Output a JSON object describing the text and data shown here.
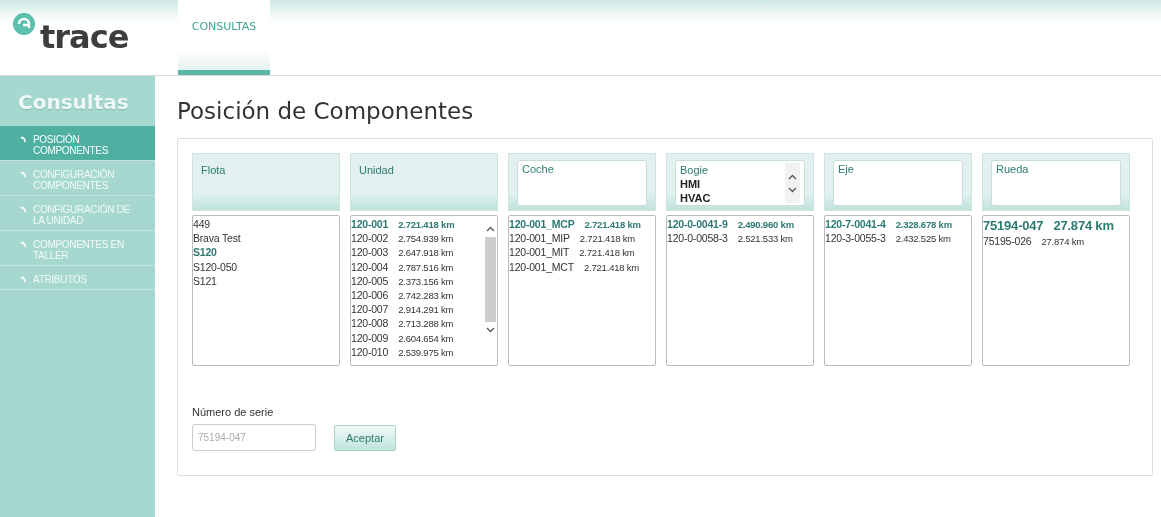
{
  "brand": {
    "name": "trace"
  },
  "top_tabs": [
    {
      "label": "CONSULTAS",
      "selected": true
    }
  ],
  "sidebar": {
    "title": "Consultas",
    "items": [
      {
        "label": "POSICIÓN COMPONENTES",
        "selected": true
      },
      {
        "label": "CONFIGURACIÓN COMPONENTES",
        "selected": false
      },
      {
        "label": "CONFIGURACIÓN DE LA UNIDAD",
        "selected": false
      },
      {
        "label": "COMPONENTES EN TALLER",
        "selected": false
      },
      {
        "label": "ATRIBUTOS",
        "selected": false
      }
    ]
  },
  "page_title": "Posición de Componentes",
  "panels": [
    {
      "label": "Flota",
      "kind": "label",
      "scrollable": false,
      "items": [
        {
          "code": "449",
          "selected": false
        },
        {
          "code": "Brava Test",
          "selected": false
        },
        {
          "code": "S120",
          "selected": true
        },
        {
          "code": "S120-050",
          "selected": false
        },
        {
          "code": "S121",
          "selected": false
        }
      ]
    },
    {
      "label": "Unidad",
      "kind": "label",
      "scrollable": true,
      "items": [
        {
          "code": "120-001",
          "km": "2.721.418 km",
          "selected": true
        },
        {
          "code": "120-002",
          "km": "2.754.939 km",
          "selected": false
        },
        {
          "code": "120-003",
          "km": "2.647.918 km",
          "selected": false
        },
        {
          "code": "120-004",
          "km": "2.787.516 km",
          "selected": false
        },
        {
          "code": "120-005",
          "km": "2.373.156 km",
          "selected": false
        },
        {
          "code": "120-006",
          "km": "2.742.283 km",
          "selected": false
        },
        {
          "code": "120-007",
          "km": "2.914.291 km",
          "selected": false
        },
        {
          "code": "120-008",
          "km": "2.713.288 km",
          "selected": false
        },
        {
          "code": "120-009",
          "km": "2.604.654 km",
          "selected": false
        },
        {
          "code": "120-010",
          "km": "2.539.975 km",
          "selected": false
        }
      ]
    },
    {
      "label": "Coche",
      "kind": "box",
      "scrollable": false,
      "items": [
        {
          "code": "120-001_MCP",
          "km": "2.721.418 km",
          "selected": true
        },
        {
          "code": "120-001_MIP",
          "km": "2.721.418 km",
          "selected": false
        },
        {
          "code": "120-001_MIT",
          "km": "2.721.418 km",
          "selected": false
        },
        {
          "code": "120-001_MCT",
          "km": "2.721.418 km",
          "selected": false
        }
      ]
    },
    {
      "label": "Bogie",
      "kind": "select",
      "options": [
        "HMI",
        "HVAC"
      ],
      "scrollable": false,
      "items": [
        {
          "code": "120-0-0041-9",
          "km": "2.490.960 km",
          "selected": true
        },
        {
          "code": "120-0-0058-3",
          "km": "2.521.533 km",
          "selected": false
        }
      ]
    },
    {
      "label": "Eje",
      "kind": "box",
      "scrollable": false,
      "items": [
        {
          "code": "120-7-0041-4",
          "km": "2.328.678 km",
          "selected": true
        },
        {
          "code": "120-3-0055-3",
          "km": "2.432.525 km",
          "selected": false
        }
      ]
    },
    {
      "label": "Rueda",
      "kind": "box",
      "scrollable": false,
      "items": [
        {
          "code": "75194-047",
          "km": "27.874 km",
          "selected": true
        },
        {
          "code": "75195-026",
          "km": "27.874 km",
          "selected": false
        }
      ]
    }
  ],
  "serial": {
    "label": "Número de serie",
    "placeholder": "75194-047"
  },
  "accept_button": "Aceptar"
}
